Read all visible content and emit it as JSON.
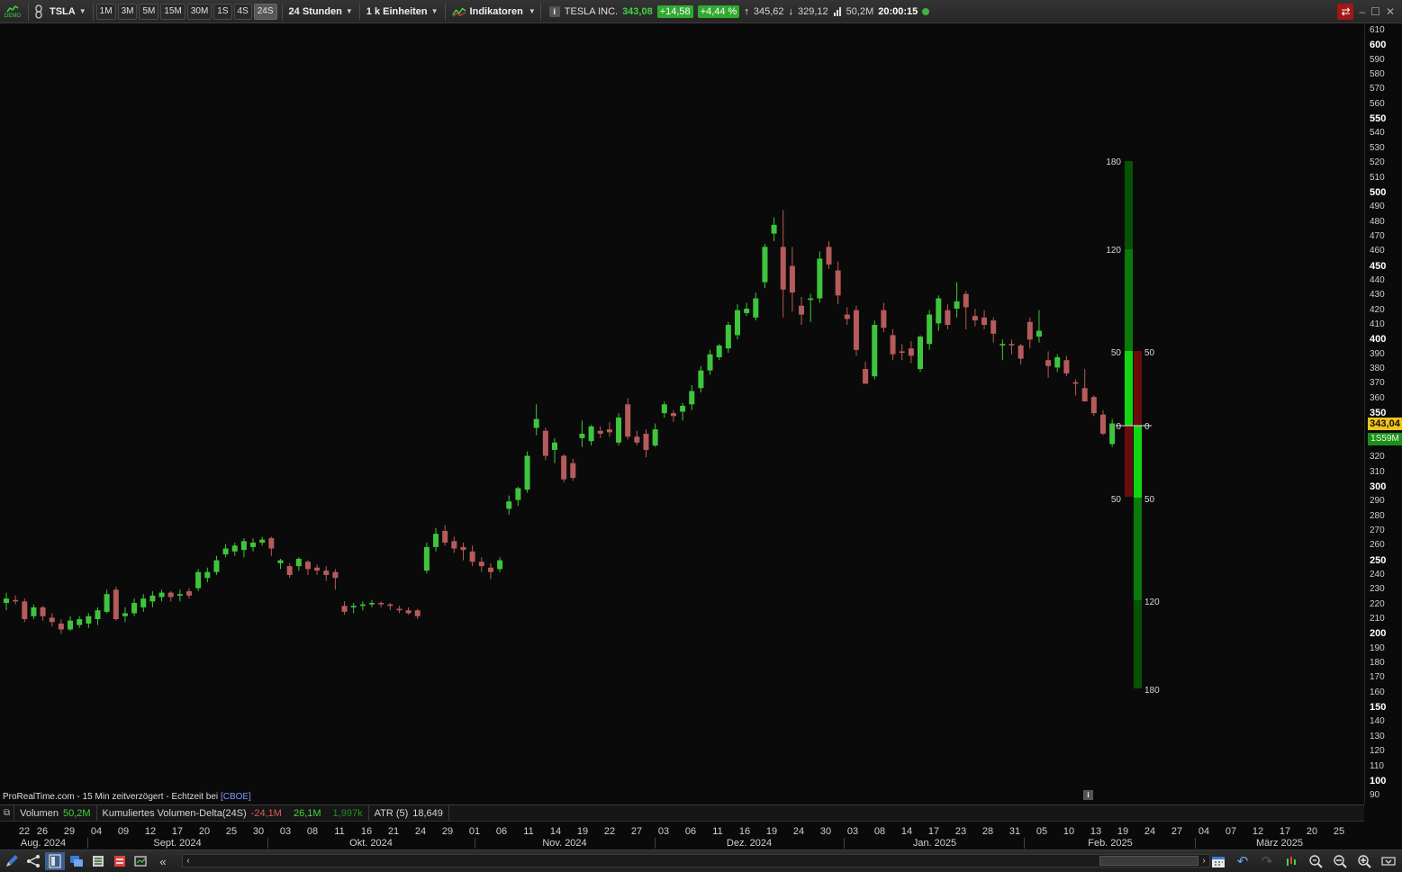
{
  "toolbar": {
    "demo_label": "DEMO",
    "symbol": "TSLA",
    "timeframes": [
      "1M",
      "3M",
      "5M",
      "15M",
      "30M",
      "1S",
      "4S",
      "24S"
    ],
    "active_timeframe": "24S",
    "session": "24 Stunden",
    "units": "1 k Einheiten",
    "indicators": "Indikatoren",
    "quote": {
      "name": "TESLA INC.",
      "last": "343,08",
      "change": "+14,58",
      "change_pct": "+4,44 %",
      "high": "345,62",
      "low": "329,12",
      "volume": "50,2M",
      "time": "20:00:15"
    }
  },
  "price_axis": {
    "labels": [
      {
        "v": 610,
        "t": "610",
        "bold": false
      },
      {
        "v": 600,
        "t": "600",
        "bold": true
      },
      {
        "v": 590,
        "t": "590",
        "bold": false
      },
      {
        "v": 580,
        "t": "580",
        "bold": false
      },
      {
        "v": 570,
        "t": "570",
        "bold": false
      },
      {
        "v": 560,
        "t": "560",
        "bold": false
      },
      {
        "v": 550,
        "t": "550",
        "bold": true
      },
      {
        "v": 540,
        "t": "540",
        "bold": false
      },
      {
        "v": 530,
        "t": "530",
        "bold": false
      },
      {
        "v": 520,
        "t": "520",
        "bold": false
      },
      {
        "v": 510,
        "t": "510",
        "bold": false
      },
      {
        "v": 500,
        "t": "500",
        "bold": true
      },
      {
        "v": 490,
        "t": "490",
        "bold": false
      },
      {
        "v": 480,
        "t": "480",
        "bold": false
      },
      {
        "v": 470,
        "t": "470",
        "bold": false
      },
      {
        "v": 460,
        "t": "460",
        "bold": false
      },
      {
        "v": 450,
        "t": "450",
        "bold": true
      },
      {
        "v": 440,
        "t": "440",
        "bold": false
      },
      {
        "v": 430,
        "t": "430",
        "bold": false
      },
      {
        "v": 420,
        "t": "420",
        "bold": false
      },
      {
        "v": 410,
        "t": "410",
        "bold": false
      },
      {
        "v": 400,
        "t": "400",
        "bold": true
      },
      {
        "v": 390,
        "t": "390",
        "bold": false
      },
      {
        "v": 380,
        "t": "380",
        "bold": false
      },
      {
        "v": 370,
        "t": "370",
        "bold": false
      },
      {
        "v": 360,
        "t": "360",
        "bold": false
      },
      {
        "v": 350,
        "t": "350",
        "bold": true
      },
      {
        "v": 320,
        "t": "320",
        "bold": false
      },
      {
        "v": 310,
        "t": "310",
        "bold": false
      },
      {
        "v": 300,
        "t": "300",
        "bold": true
      },
      {
        "v": 290,
        "t": "290",
        "bold": false
      },
      {
        "v": 280,
        "t": "280",
        "bold": false
      },
      {
        "v": 270,
        "t": "270",
        "bold": false
      },
      {
        "v": 260,
        "t": "260",
        "bold": false
      },
      {
        "v": 250,
        "t": "250",
        "bold": true
      },
      {
        "v": 240,
        "t": "240",
        "bold": false
      },
      {
        "v": 230,
        "t": "230",
        "bold": false
      },
      {
        "v": 220,
        "t": "220",
        "bold": false
      },
      {
        "v": 210,
        "t": "210",
        "bold": false
      },
      {
        "v": 200,
        "t": "200",
        "bold": true
      },
      {
        "v": 190,
        "t": "190",
        "bold": false
      },
      {
        "v": 180,
        "t": "180",
        "bold": false
      },
      {
        "v": 170,
        "t": "170",
        "bold": false
      },
      {
        "v": 160,
        "t": "160",
        "bold": false
      },
      {
        "v": 150,
        "t": "150",
        "bold": true
      },
      {
        "v": 140,
        "t": "140",
        "bold": false
      },
      {
        "v": 130,
        "t": "130",
        "bold": false
      },
      {
        "v": 120,
        "t": "120",
        "bold": false
      },
      {
        "v": 110,
        "t": "110",
        "bold": false
      },
      {
        "v": 100,
        "t": "100",
        "bold": true
      },
      {
        "v": 90,
        "t": "90",
        "bold": false
      }
    ],
    "current_price_tag": "343,04",
    "volume_tag": "1S59M"
  },
  "source_note": {
    "text": "ProRealTime.com - 15 Min zeitverzögert - Echtzeit bei",
    "exchange": "[CBOE]"
  },
  "indicator_bar": {
    "volume_label": "Volumen",
    "volume_value": "50,2M",
    "delta_label": "Kumuliertes Volumen-Delta(24S)",
    "delta_value": "-24,1M",
    "delta_value2": "26,1M",
    "delta_value3": "1,997k",
    "atr_label": "ATR (5)",
    "atr_value": "18,649"
  },
  "date_axis": {
    "days": [
      "22",
      "26",
      "29",
      "04",
      "09",
      "12",
      "17",
      "20",
      "25",
      "30",
      "03",
      "08",
      "11",
      "16",
      "21",
      "24",
      "29",
      "01",
      "06",
      "11",
      "14",
      "19",
      "22",
      "27",
      "03",
      "06",
      "11",
      "16",
      "19",
      "24",
      "30",
      "03",
      "08",
      "14",
      "17",
      "23",
      "28",
      "31",
      "05",
      "10",
      "13",
      "19",
      "24",
      "27",
      "04",
      "07",
      "12",
      "17",
      "20",
      "25"
    ],
    "months": [
      "Aug. 2024",
      "Sept. 2024",
      "Okt. 2024",
      "Nov. 2024",
      "Dez. 2024",
      "Jan. 2025",
      "Feb. 2025",
      "März 2025"
    ]
  },
  "delta_gauge": {
    "left_labels": [
      "180",
      "120",
      "50",
      "0",
      "50"
    ],
    "right_labels": [
      "50",
      "0",
      "50",
      "120",
      "180"
    ],
    "colors": {
      "green": "#11d711",
      "dark_green": "#0a7a0a",
      "deep_green": "#065306",
      "red": "#6b0c0c"
    }
  },
  "colors": {
    "up": "#3ec53e",
    "down": "#b65b5b",
    "bg": "#0b0a0a",
    "accent": "#2faa2f",
    "price_tag": "#f0c419"
  },
  "chart_data": {
    "type": "candlestick",
    "title": "TSLA",
    "ylim": [
      85,
      615
    ],
    "candles": [
      {
        "o": 221,
        "h": 228,
        "l": 216,
        "c": 224
      },
      {
        "o": 223,
        "h": 226,
        "l": 220,
        "c": 222
      },
      {
        "o": 222,
        "h": 224,
        "l": 208,
        "c": 210
      },
      {
        "o": 212,
        "h": 220,
        "l": 210,
        "c": 218
      },
      {
        "o": 218,
        "h": 219,
        "l": 209,
        "c": 212
      },
      {
        "o": 211,
        "h": 214,
        "l": 205,
        "c": 208
      },
      {
        "o": 207,
        "h": 210,
        "l": 200,
        "c": 203
      },
      {
        "o": 203,
        "h": 212,
        "l": 202,
        "c": 209
      },
      {
        "o": 206,
        "h": 212,
        "l": 204,
        "c": 210
      },
      {
        "o": 207,
        "h": 214,
        "l": 204,
        "c": 212
      },
      {
        "o": 210,
        "h": 218,
        "l": 206,
        "c": 216
      },
      {
        "o": 215,
        "h": 230,
        "l": 214,
        "c": 227
      },
      {
        "o": 230,
        "h": 232,
        "l": 209,
        "c": 210
      },
      {
        "o": 212,
        "h": 218,
        "l": 208,
        "c": 214
      },
      {
        "o": 214,
        "h": 224,
        "l": 212,
        "c": 221
      },
      {
        "o": 218,
        "h": 227,
        "l": 215,
        "c": 224
      },
      {
        "o": 222,
        "h": 229,
        "l": 218,
        "c": 226
      },
      {
        "o": 225,
        "h": 230,
        "l": 222,
        "c": 228
      },
      {
        "o": 228,
        "h": 229,
        "l": 222,
        "c": 225
      },
      {
        "o": 226,
        "h": 230,
        "l": 222,
        "c": 227
      },
      {
        "o": 229,
        "h": 231,
        "l": 224,
        "c": 226
      },
      {
        "o": 231,
        "h": 244,
        "l": 229,
        "c": 242
      },
      {
        "o": 238,
        "h": 245,
        "l": 235,
        "c": 242
      },
      {
        "o": 242,
        "h": 253,
        "l": 240,
        "c": 250
      },
      {
        "o": 254,
        "h": 261,
        "l": 252,
        "c": 258
      },
      {
        "o": 256,
        "h": 262,
        "l": 253,
        "c": 260
      },
      {
        "o": 257,
        "h": 265,
        "l": 252,
        "c": 263
      },
      {
        "o": 259,
        "h": 265,
        "l": 256,
        "c": 262
      },
      {
        "o": 262,
        "h": 266,
        "l": 260,
        "c": 264
      },
      {
        "o": 265,
        "h": 266,
        "l": 253,
        "c": 258
      },
      {
        "o": 248,
        "h": 251,
        "l": 244,
        "c": 250
      },
      {
        "o": 246,
        "h": 248,
        "l": 238,
        "c": 240
      },
      {
        "o": 246,
        "h": 252,
        "l": 243,
        "c": 251
      },
      {
        "o": 249,
        "h": 250,
        "l": 240,
        "c": 244
      },
      {
        "o": 245,
        "h": 247,
        "l": 240,
        "c": 243
      },
      {
        "o": 243,
        "h": 246,
        "l": 236,
        "c": 240
      },
      {
        "o": 242,
        "h": 244,
        "l": 230,
        "c": 238
      },
      {
        "o": 219,
        "h": 222,
        "l": 213,
        "c": 215
      },
      {
        "o": 218,
        "h": 221,
        "l": 214,
        "c": 219
      },
      {
        "o": 219,
        "h": 222,
        "l": 216,
        "c": 220
      },
      {
        "o": 220,
        "h": 223,
        "l": 218,
        "c": 221
      },
      {
        "o": 221,
        "h": 222,
        "l": 218,
        "c": 220
      },
      {
        "o": 220,
        "h": 221,
        "l": 216,
        "c": 219
      },
      {
        "o": 217,
        "h": 219,
        "l": 214,
        "c": 216
      },
      {
        "o": 216,
        "h": 218,
        "l": 213,
        "c": 214
      },
      {
        "o": 216,
        "h": 217,
        "l": 210,
        "c": 212
      },
      {
        "o": 243,
        "h": 262,
        "l": 241,
        "c": 259
      },
      {
        "o": 259,
        "h": 272,
        "l": 256,
        "c": 268
      },
      {
        "o": 270,
        "h": 274,
        "l": 260,
        "c": 262
      },
      {
        "o": 263,
        "h": 266,
        "l": 255,
        "c": 258
      },
      {
        "o": 259,
        "h": 262,
        "l": 250,
        "c": 257
      },
      {
        "o": 256,
        "h": 260,
        "l": 246,
        "c": 249
      },
      {
        "o": 249,
        "h": 252,
        "l": 242,
        "c": 246
      },
      {
        "o": 245,
        "h": 248,
        "l": 237,
        "c": 242
      },
      {
        "o": 244,
        "h": 252,
        "l": 242,
        "c": 250
      },
      {
        "o": 285,
        "h": 294,
        "l": 281,
        "c": 290
      },
      {
        "o": 291,
        "h": 300,
        "l": 287,
        "c": 299
      },
      {
        "o": 298,
        "h": 324,
        "l": 296,
        "c": 321
      },
      {
        "o": 340,
        "h": 356,
        "l": 335,
        "c": 346
      },
      {
        "o": 338,
        "h": 340,
        "l": 318,
        "c": 321
      },
      {
        "o": 325,
        "h": 333,
        "l": 316,
        "c": 330
      },
      {
        "o": 321,
        "h": 322,
        "l": 303,
        "c": 305
      },
      {
        "o": 316,
        "h": 319,
        "l": 304,
        "c": 306
      },
      {
        "o": 333,
        "h": 345,
        "l": 327,
        "c": 336
      },
      {
        "o": 331,
        "h": 342,
        "l": 328,
        "c": 341
      },
      {
        "o": 338,
        "h": 341,
        "l": 333,
        "c": 336
      },
      {
        "o": 339,
        "h": 344,
        "l": 334,
        "c": 337
      },
      {
        "o": 330,
        "h": 350,
        "l": 328,
        "c": 347
      },
      {
        "o": 356,
        "h": 360,
        "l": 332,
        "c": 334
      },
      {
        "o": 334,
        "h": 338,
        "l": 328,
        "c": 330
      },
      {
        "o": 336,
        "h": 339,
        "l": 320,
        "c": 325
      },
      {
        "o": 328,
        "h": 343,
        "l": 327,
        "c": 339
      },
      {
        "o": 350,
        "h": 358,
        "l": 347,
        "c": 356
      },
      {
        "o": 350,
        "h": 352,
        "l": 344,
        "c": 348
      },
      {
        "o": 351,
        "h": 357,
        "l": 345,
        "c": 355
      },
      {
        "o": 356,
        "h": 369,
        "l": 352,
        "c": 365
      },
      {
        "o": 367,
        "h": 382,
        "l": 364,
        "c": 379
      },
      {
        "o": 379,
        "h": 393,
        "l": 376,
        "c": 390
      },
      {
        "o": 388,
        "h": 397,
        "l": 386,
        "c": 396
      },
      {
        "o": 394,
        "h": 412,
        "l": 391,
        "c": 410
      },
      {
        "o": 403,
        "h": 424,
        "l": 400,
        "c": 420
      },
      {
        "o": 418,
        "h": 425,
        "l": 416,
        "c": 421
      },
      {
        "o": 415,
        "h": 432,
        "l": 413,
        "c": 428
      },
      {
        "o": 439,
        "h": 465,
        "l": 435,
        "c": 463
      },
      {
        "o": 472,
        "h": 483,
        "l": 467,
        "c": 478
      },
      {
        "o": 463,
        "h": 488,
        "l": 415,
        "c": 434
      },
      {
        "o": 450,
        "h": 463,
        "l": 419,
        "c": 432
      },
      {
        "o": 423,
        "h": 429,
        "l": 410,
        "c": 417
      },
      {
        "o": 427,
        "h": 431,
        "l": 412,
        "c": 428
      },
      {
        "o": 428,
        "h": 460,
        "l": 425,
        "c": 455
      },
      {
        "o": 463,
        "h": 467,
        "l": 448,
        "c": 451
      },
      {
        "o": 447,
        "h": 453,
        "l": 424,
        "c": 430
      },
      {
        "o": 417,
        "h": 422,
        "l": 410,
        "c": 414
      },
      {
        "o": 420,
        "h": 423,
        "l": 389,
        "c": 393
      },
      {
        "o": 380,
        "h": 385,
        "l": 371,
        "c": 370
      },
      {
        "o": 375,
        "h": 413,
        "l": 373,
        "c": 410
      },
      {
        "o": 420,
        "h": 425,
        "l": 405,
        "c": 408
      },
      {
        "o": 403,
        "h": 407,
        "l": 386,
        "c": 390
      },
      {
        "o": 392,
        "h": 397,
        "l": 386,
        "c": 391
      },
      {
        "o": 394,
        "h": 399,
        "l": 384,
        "c": 389
      },
      {
        "o": 380,
        "h": 403,
        "l": 378,
        "c": 402
      },
      {
        "o": 397,
        "h": 420,
        "l": 393,
        "c": 417
      },
      {
        "o": 411,
        "h": 430,
        "l": 406,
        "c": 428
      },
      {
        "o": 420,
        "h": 424,
        "l": 407,
        "c": 410
      },
      {
        "o": 421,
        "h": 439,
        "l": 415,
        "c": 426
      },
      {
        "o": 431,
        "h": 433,
        "l": 407,
        "c": 422
      },
      {
        "o": 416,
        "h": 421,
        "l": 409,
        "c": 413
      },
      {
        "o": 415,
        "h": 420,
        "l": 407,
        "c": 410
      },
      {
        "o": 413,
        "h": 415,
        "l": 398,
        "c": 404
      },
      {
        "o": 396,
        "h": 400,
        "l": 386,
        "c": 397
      },
      {
        "o": 397,
        "h": 400,
        "l": 390,
        "c": 396
      },
      {
        "o": 396,
        "h": 397,
        "l": 383,
        "c": 387
      },
      {
        "o": 412,
        "h": 415,
        "l": 394,
        "c": 400
      },
      {
        "o": 402,
        "h": 420,
        "l": 398,
        "c": 406
      },
      {
        "o": 386,
        "h": 392,
        "l": 374,
        "c": 382
      },
      {
        "o": 381,
        "h": 390,
        "l": 378,
        "c": 388
      },
      {
        "o": 386,
        "h": 389,
        "l": 375,
        "c": 377
      },
      {
        "o": 371,
        "h": 373,
        "l": 362,
        "c": 370
      },
      {
        "o": 367,
        "h": 380,
        "l": 358,
        "c": 358
      },
      {
        "o": 361,
        "h": 362,
        "l": 348,
        "c": 350
      },
      {
        "o": 349,
        "h": 352,
        "l": 335,
        "c": 336
      },
      {
        "o": 329,
        "h": 346,
        "l": 327,
        "c": 343
      }
    ]
  }
}
